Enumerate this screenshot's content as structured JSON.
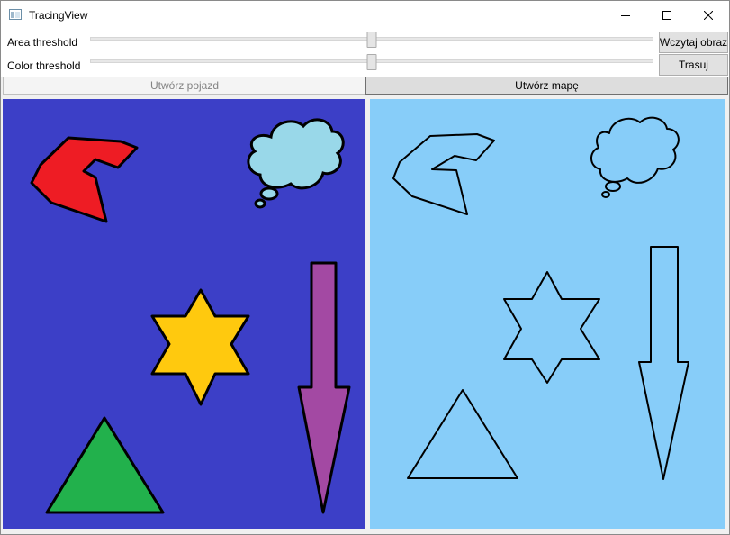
{
  "window": {
    "title": "TracingView",
    "buttons": {
      "minimize": "minimize",
      "maximize": "maximize",
      "close": "close"
    }
  },
  "controls": {
    "area_threshold": {
      "label": "Area threshold",
      "value": 0.5
    },
    "color_threshold": {
      "label": "Color threshold",
      "value": 0.5
    },
    "load_image_button": "Wczytaj obraz",
    "trace_button": "Trasuj"
  },
  "actions": {
    "create_vehicle": {
      "label": "Utwórz pojazd",
      "enabled": false
    },
    "create_map": {
      "label": "Utwórz mapę",
      "enabled": true
    }
  },
  "source_image": {
    "background": "#3c3fc7",
    "shapes": [
      {
        "name": "polygon-hook",
        "fill": "#ee1c24"
      },
      {
        "name": "thought-cloud",
        "fill": "#99d8e9"
      },
      {
        "name": "six-point-star",
        "fill": "#ffc90e"
      },
      {
        "name": "down-arrow",
        "fill": "#a349a3"
      },
      {
        "name": "triangle",
        "fill": "#22b14c"
      }
    ]
  },
  "traced_image": {
    "background": "#87cdf9",
    "stroke": "#000000"
  }
}
